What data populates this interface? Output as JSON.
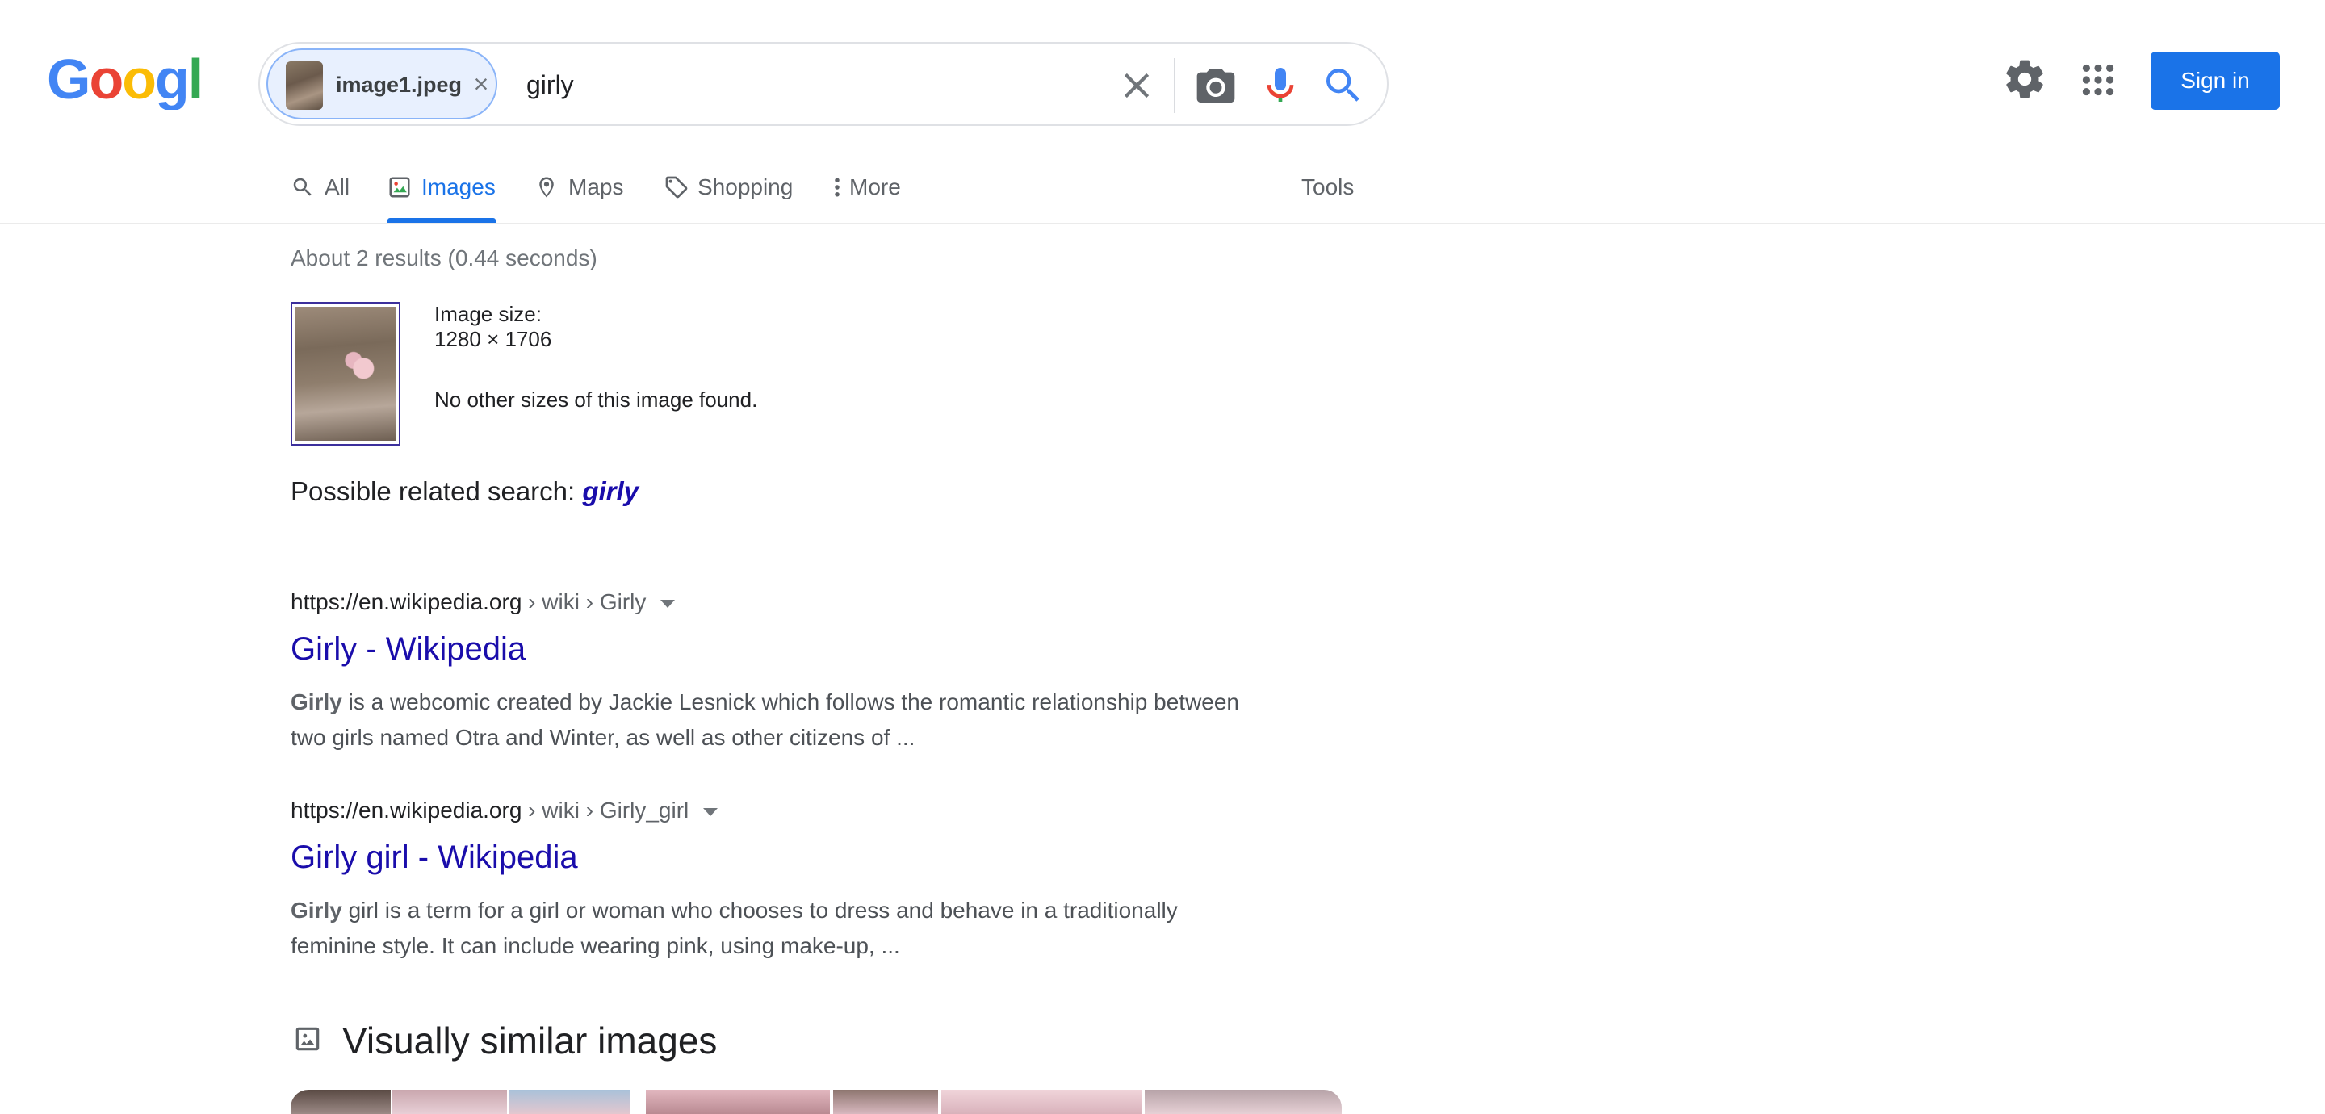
{
  "header": {
    "logo_text": "Google",
    "logo_colors": [
      "#4285F4",
      "#EA4335",
      "#FBBC05",
      "#4285F4",
      "#34A853",
      "#EA4335"
    ],
    "sign_in_label": "Sign in"
  },
  "search": {
    "chip_label": "image1.jpeg",
    "query": "girly"
  },
  "icons": {
    "clear": "close-icon",
    "camera": "camera-icon",
    "mic": "mic-icon",
    "search": "search-icon",
    "settings": "gear-icon",
    "apps": "apps-grid-icon"
  },
  "tabs": [
    {
      "label": "All",
      "icon": "search-icon"
    },
    {
      "label": "Images",
      "icon": "image-icon",
      "active": true
    },
    {
      "label": "Maps",
      "icon": "map-pin-icon"
    },
    {
      "label": "Shopping",
      "icon": "tag-icon"
    },
    {
      "label": "More",
      "icon": "more-vert-icon"
    }
  ],
  "tools_label": "Tools",
  "stats": "About 2 results (0.44 seconds)",
  "image_info": {
    "size_label": "Image size:",
    "size_value": "1280 × 1706",
    "no_sizes": "No other sizes of this image found."
  },
  "related": {
    "prefix": "Possible related search: ",
    "term": "girly"
  },
  "results": [
    {
      "url": "https://en.wikipedia.org",
      "path": " › wiki › Girly",
      "title": "Girly - Wikipedia",
      "snippet_bold": "Girly",
      "snippet": " is a webcomic created by Jackie Lesnick which follows the romantic relationship between two girls named Otra and Winter, as well as other citizens of ..."
    },
    {
      "url": "https://en.wikipedia.org",
      "path": " › wiki › Girly_girl",
      "title": "Girly girl - Wikipedia",
      "snippet_bold": "Girly",
      "snippet": " girl is a term for a girl or woman who chooses to dress and behave in a traditionally feminine style. It can include wearing pink, using make-up, ..."
    }
  ],
  "similar_heading": "Visually similar images",
  "colors": {
    "accent": "#1a73e8",
    "link": "#1a0dab",
    "visited_border": "#3c2f9c"
  }
}
